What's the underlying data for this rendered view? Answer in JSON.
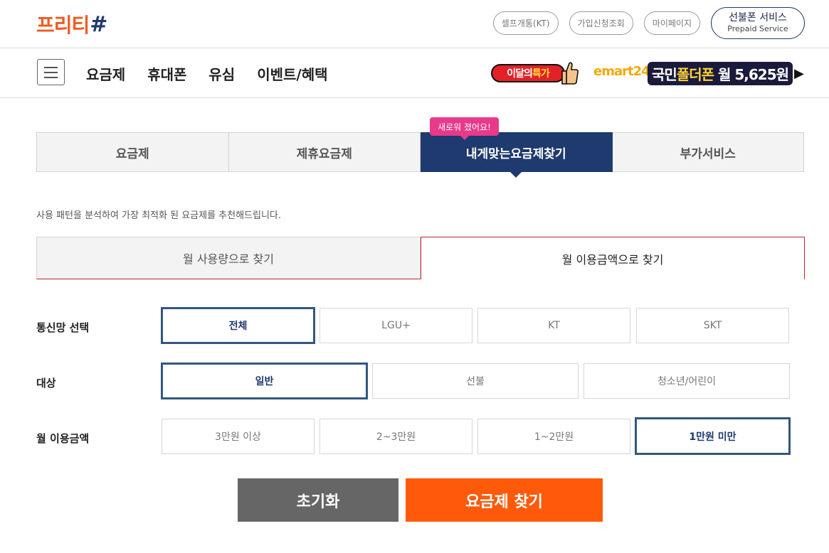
{
  "header": {
    "logo_text": "프리티",
    "logo_hash": "#",
    "links": [
      "셀프개통(KT)",
      "가입신청조회",
      "마이페이지"
    ],
    "prepaid_title": "선불폰 서비스",
    "prepaid_sub": "Prepaid Service"
  },
  "nav": {
    "items": [
      "요금제",
      "휴대폰",
      "유심",
      "이벤트/혜택"
    ],
    "special_prefix": "이달의",
    "special_word": "특가",
    "emart": "emart",
    "emart_num": "24",
    "folder_prefix": "국민",
    "folder_word": "폴더폰",
    "folder_price": "월 5,625원",
    "folder_arrow": "▶"
  },
  "tabs": {
    "items": [
      "요금제",
      "제휴요금제",
      "내게맞는요금제찾기",
      "부가서비스"
    ],
    "active_index": 2,
    "badge": "새로워 졌어요!"
  },
  "description": "사용 패턴을 분석하여 가장 최적화 된 요금제를 추천해드립니다.",
  "sub_tabs": {
    "usage": "월 사용량으로 찾기",
    "amount": "월 이용금액으로 찾기"
  },
  "filters": {
    "network": {
      "label": "통신망 선택",
      "options": [
        "전체",
        "LGU+",
        "KT",
        "SKT"
      ],
      "selected": "전체"
    },
    "target": {
      "label": "대상",
      "options": [
        "일반",
        "선불",
        "청소년/어린이"
      ],
      "selected": "일반"
    },
    "amount": {
      "label": "월 이용금액",
      "options": [
        "3만원 이상",
        "2~3만원",
        "1~2만원",
        "1만원 미만"
      ],
      "selected": "1만원 미만"
    }
  },
  "buttons": {
    "reset": "초기화",
    "find": "요금제 찾기"
  },
  "colors": {
    "brand_orange": "#f05a22",
    "navy": "#1e3a6e",
    "badge_pink": "#e8398a",
    "find_button": "#ff5a0a",
    "reset_button": "#666666"
  }
}
